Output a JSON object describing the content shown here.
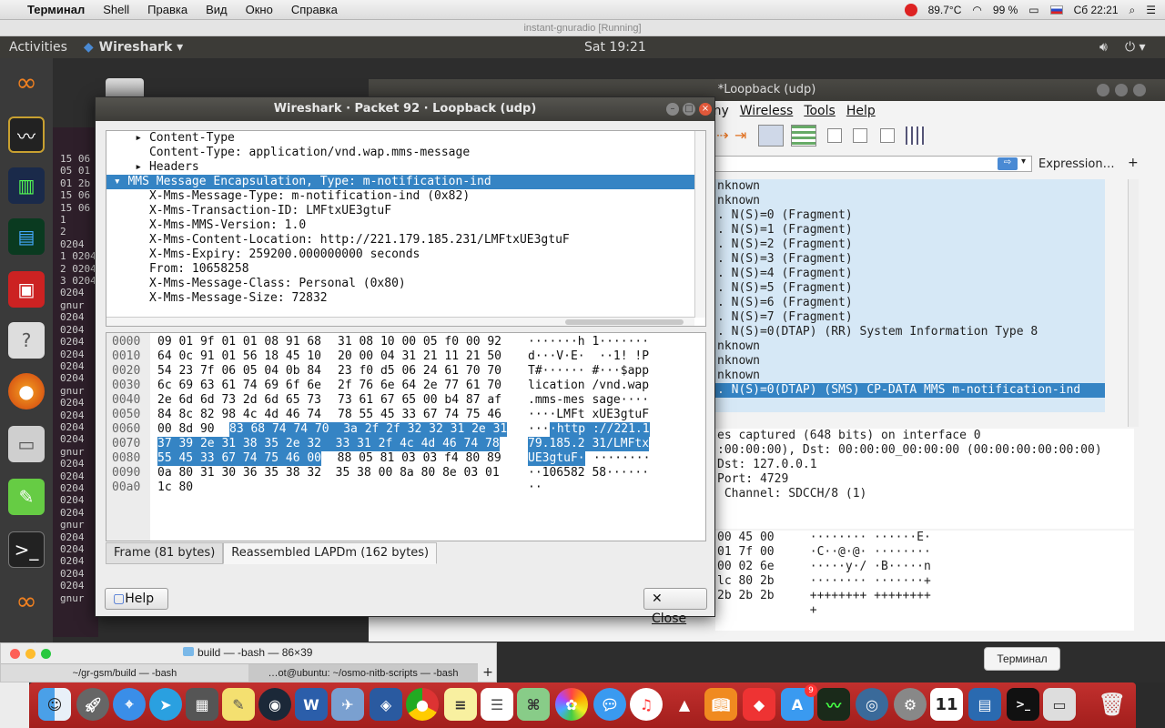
{
  "macbar": {
    "apple": "",
    "app": "Терминал",
    "menus": [
      "Shell",
      "Правка",
      "Вид",
      "Окно",
      "Справка"
    ],
    "temp": "89.7°C",
    "battery": "99 %",
    "clock": "Сб 22:21"
  },
  "vm_title": "instant-gnuradio [Running]",
  "ubuntu": {
    "activities": "Activities",
    "app": "Wireshark ▾",
    "clock": "Sat 19:21"
  },
  "main_window": {
    "title": "*Loopback (udp)",
    "menus": [
      "ony",
      "Wireless",
      "Tools",
      "Help"
    ],
    "filter_expr": "Expression…",
    "filter_plus": "+",
    "packets": [
      "nknown",
      "nknown",
      ". N(S)=0 (Fragment)",
      ". N(S)=1 (Fragment)",
      ". N(S)=2 (Fragment)",
      ". N(S)=3 (Fragment)",
      ". N(S)=4 (Fragment)",
      ". N(S)=5 (Fragment)",
      ". N(S)=6 (Fragment)",
      ". N(S)=7 (Fragment)",
      ". N(S)=0(DTAP) (RR) System Information Type 8",
      "nknown",
      "nknown",
      "nknown",
      ". N(S)=0(DTAP) (SMS) CP-DATA MMS m-notification-ind"
    ],
    "details": [
      "es captured (648 bits) on interface 0",
      ":00:00:00), Dst: 00:00:00_00:00:00 (00:00:00:00:00:00)",
      "Dst: 127.0.0.1",
      "Port: 4729",
      " Channel: SDCCH/8 (1)"
    ],
    "bytes": [
      "00 45 00     ········ ······E·",
      "01 7f 00     ·C··@·@· ········",
      "00 02 6e     ·····y·/ ·B·····n",
      "lc 80 2b     ········ ·······+",
      "2b 2b 2b     ++++++++ ++++++++",
      "             +"
    ]
  },
  "dialog": {
    "title": "Wireshark · Packet 92 · Loopback (udp)",
    "tree": [
      {
        "t": "    ▸ Content-Type",
        "sel": false
      },
      {
        "t": "      Content-Type: application/vnd.wap.mms-message",
        "sel": false
      },
      {
        "t": "    ▸ Headers",
        "sel": false
      },
      {
        "t": " ▾ MMS Message Encapsulation, Type: m-notification-ind",
        "sel": true
      },
      {
        "t": "      X-Mms-Message-Type: m-notification-ind (0x82)",
        "sel": false
      },
      {
        "t": "      X-Mms-Transaction-ID: LMFtxUE3gtuF",
        "sel": false
      },
      {
        "t": "      X-Mms-MMS-Version: 1.0",
        "sel": false
      },
      {
        "t": "      X-Mms-Content-Location: http://221.179.185.231/LMFtxUE3gtuF",
        "sel": false
      },
      {
        "t": "      X-Mms-Expiry: 259200.000000000 seconds",
        "sel": false
      },
      {
        "t": "      From: 10658258",
        "sel": false
      },
      {
        "t": "      X-Mms-Message-Class: Personal (0x80)",
        "sel": false
      },
      {
        "t": "      X-Mms-Message-Size: 72832",
        "sel": false
      }
    ],
    "offsets": [
      "0000",
      "0010",
      "0020",
      "0030",
      "0040",
      "0050",
      "0060",
      "0070",
      "0080",
      "0090",
      "00a0"
    ],
    "hex": [
      [
        "09 01 9f 01 01 08 91 68",
        "",
        "31 08 10 00 05 f0 00 92",
        "",
        "·······h 1·······",
        ""
      ],
      [
        "64 0c 91 01 56 18 45 10",
        "",
        "20 00 04 31 21 11 21 50",
        "",
        "d···V·E·  ··1! !P",
        ""
      ],
      [
        "54 23 7f 06 05 04 0b 84",
        "",
        "23 f0 d5 06 24 61 70 70",
        "",
        "T#······ #···$app",
        ""
      ],
      [
        "6c 69 63 61 74 69 6f 6e",
        "",
        "2f 76 6e 64 2e 77 61 70",
        "",
        "lication /vnd.wap",
        ""
      ],
      [
        "2e 6d 6d 73 2d 6d 65 73",
        "",
        "73 61 67 65 00 b4 87 af",
        "",
        ".mms-mes sage····",
        ""
      ],
      [
        "84 8c 82 98 4c 4d 46 74",
        "",
        "78 55 45 33 67 74 75 46",
        "",
        "····LMFt xUE3gtuF",
        ""
      ]
    ],
    "hex_hl": {
      "r6a": "00 8d 90 ",
      "r6b": "83 68 74 74 70  3a 2f 2f 32 32 31 2e 31",
      "r6c": "···",
      "r6d": "·http ://221.1",
      "r7": "37 39 2e 31 38 35 2e 32  33 31 2f 4c 4d 46 74 78",
      "r7a": "79.185.2 31/LMFtx",
      "r8a": "55 45 33 67 74 75 46 00",
      "r8b": "  88 05 81 03 03 f4 80 89",
      "r8c": "UE3gtuF·",
      "r8d": " ········",
      "r9": "0a 80 31 30 36 35 38 32  35 38 00 8a 80 8e 03 01",
      "r9a": "··106582 58······",
      "r10": "1c 80",
      "r10a": "··"
    },
    "tabs": [
      "Frame (81 bytes)",
      "Reassembled LAPDm (162 bytes)"
    ],
    "help": "Help",
    "close": "Close"
  },
  "term_bg": [
    "15 06",
    "05 01",
    "01 2b",
    "15 06",
    "15 06",
    "1",
    "2",
    "0204",
    "1 0204",
    "2 0204",
    "3 0204",
    "0204",
    "gnur",
    "0204",
    "0204",
    "0204",
    "0204",
    "0204",
    "0204",
    "gnur",
    "0204",
    "0204",
    "0204",
    "0204",
    "gnur",
    "0204",
    "0204",
    "0204",
    "0204",
    "0204",
    "gnur",
    "0204",
    "0204",
    "0204",
    "0204",
    "0204",
    "gnur"
  ],
  "macterm": {
    "title": "build — -bash — 86×39",
    "tab1": "~/gr-gsm/build — -bash",
    "tab2": "…ot@ubuntu: ~/osmo-nitb-scripts — -bash"
  },
  "tooltip": "Терминал",
  "dock_badge": "9",
  "dock_cal": "11"
}
